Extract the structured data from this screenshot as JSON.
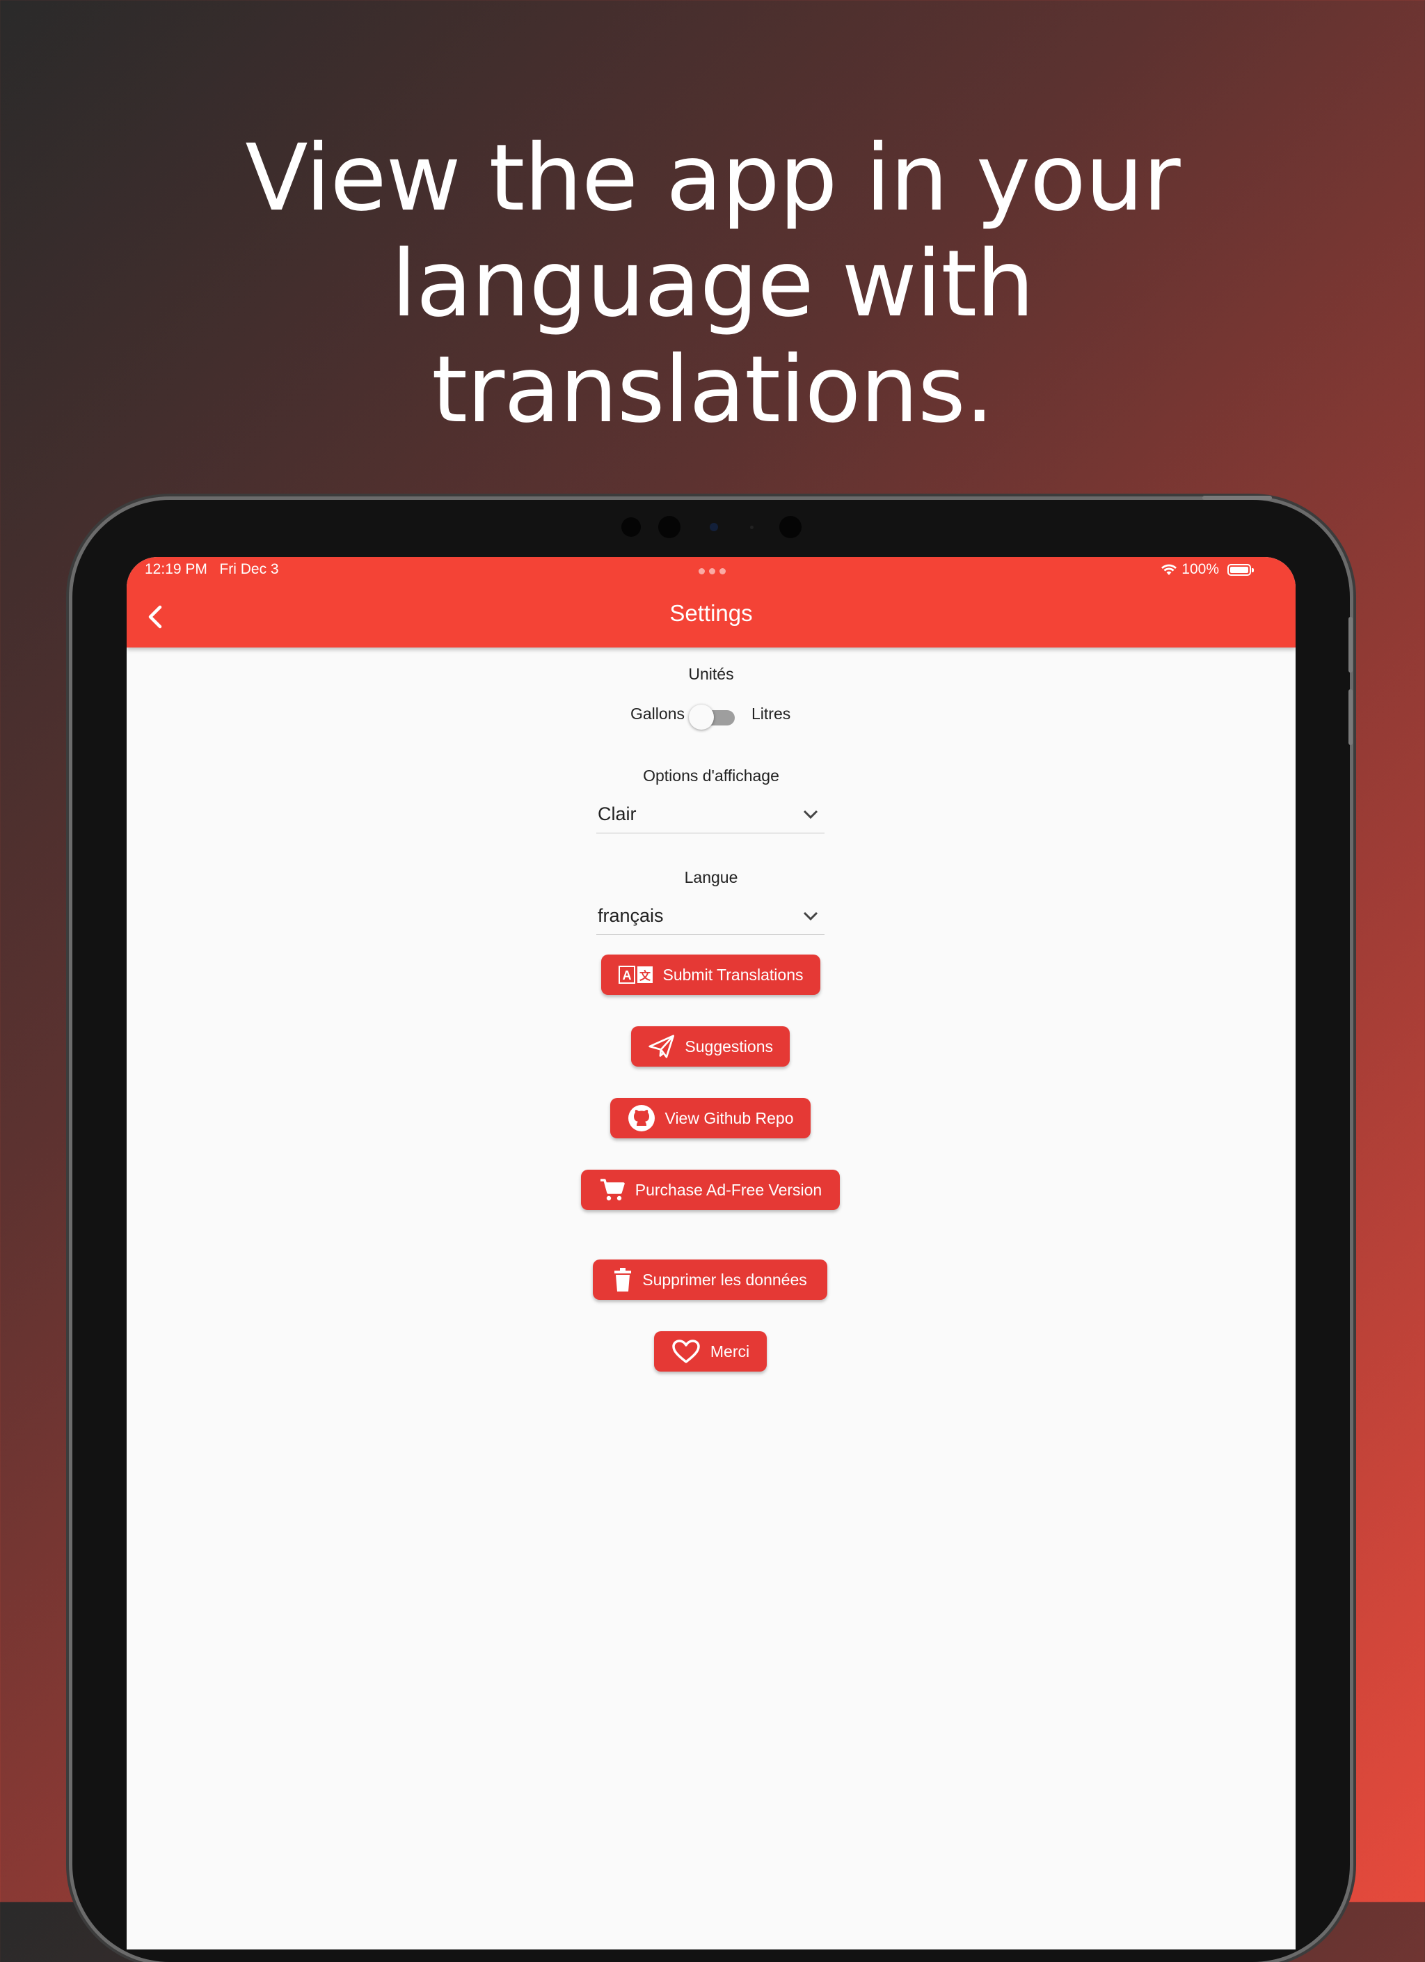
{
  "headline": {
    "line1": "View the app in your",
    "line2": "language with",
    "line3": "translations."
  },
  "status_bar": {
    "time": "12:19 PM",
    "date": "Fri Dec 3",
    "battery": "100%"
  },
  "app_bar": {
    "title": "Settings",
    "back_icon": "chevron-left-icon"
  },
  "units": {
    "label": "Unités",
    "left_option": "Gallons",
    "right_option": "Litres",
    "toggle_on": false
  },
  "display": {
    "label": "Options d'affichage",
    "selected": "Clair"
  },
  "language": {
    "label": "Langue",
    "selected": "français"
  },
  "buttons": {
    "submit_translations": "Submit Translations",
    "suggestions": "Suggestions",
    "github": "View Github Repo",
    "purchase": "Purchase Ad-Free Version",
    "delete_data": "Supprimer les données",
    "thanks": "Merci"
  },
  "colors": {
    "app_bar": "#f44336",
    "button": "#e53935",
    "background": "#fafafa"
  }
}
